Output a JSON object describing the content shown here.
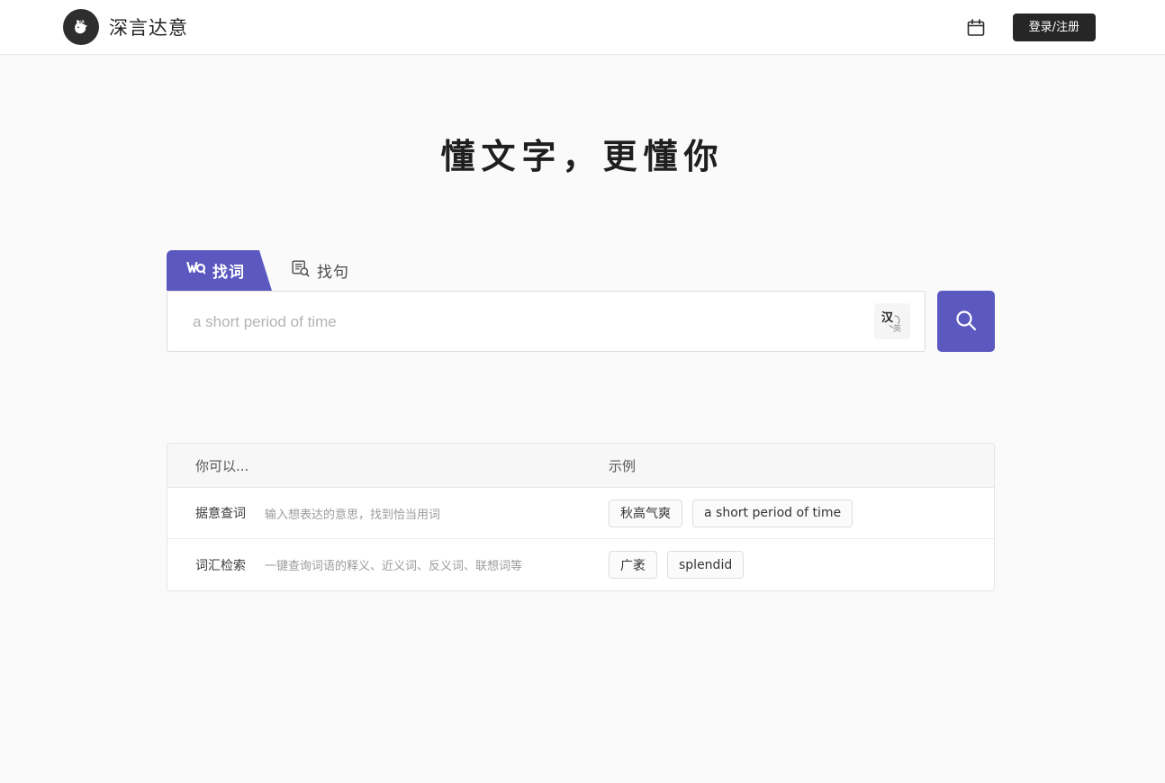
{
  "header": {
    "brand_name": "深言达意",
    "logo_icon": "rhino-logo-icon",
    "calendar_icon": "calendar-icon",
    "login_label": "登录/注册"
  },
  "hero": {
    "title": "懂文字，更懂你"
  },
  "search": {
    "tabs": [
      {
        "label": "找词",
        "icon": "word-search-icon",
        "active": true
      },
      {
        "label": "找句",
        "icon": "sentence-search-icon",
        "active": false
      }
    ],
    "input_value": "",
    "placeholder": "a short period of time",
    "lang_toggle_icon": "chinese-english-toggle-icon",
    "lang_toggle_label": "汉",
    "search_icon": "search-icon"
  },
  "info_table": {
    "headers": [
      "你可以...",
      "示例"
    ],
    "rows": [
      {
        "name": "据意查词",
        "desc": "输入想表达的意思，找到恰当用词",
        "examples": [
          "秋高气爽",
          "a short period of time"
        ]
      },
      {
        "name": "词汇检索",
        "desc": "一键查询词语的释义、近义词、反义词、联想词等",
        "examples": [
          "广袤",
          "splendid"
        ]
      }
    ]
  },
  "colors": {
    "accent_purple": "#5b58bf",
    "login_dark": "#262626",
    "page_background": "#fafafa"
  }
}
